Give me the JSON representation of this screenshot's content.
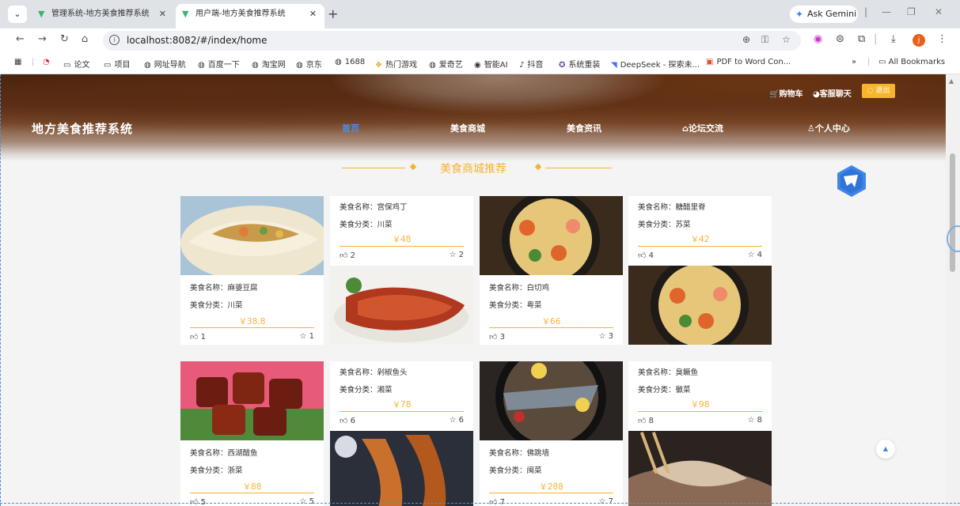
{
  "browser": {
    "tabs": [
      {
        "title": "管理系统-地方美食推荐系统",
        "close": "✕"
      },
      {
        "title": "用户端-地方美食推荐系统",
        "close": "✕"
      }
    ],
    "new_tab": "+",
    "gemini": "Ask Gemini",
    "url": "localhost:8082/#/index/home",
    "bookmarks": [
      "论文",
      "项目",
      "网址导航",
      "百度一下",
      "淘宝网",
      "京东",
      "1688",
      "热门游戏",
      "爱奇艺",
      "智能AI",
      "抖音",
      "系统重装",
      "DeepSeek - 探索未...",
      "PDF to Word Con..."
    ],
    "more": "»",
    "all_bookmarks": "All Bookmarks",
    "avatar_letter": "j",
    "accent": "#4a90e2"
  },
  "header": {
    "cart": "购物车",
    "chat": "客服聊天",
    "logout": "退出",
    "brand": "地方美食推荐系统",
    "nav": [
      {
        "label": "首页",
        "active": true
      },
      {
        "label": "美食商城",
        "active": false
      },
      {
        "label": "美食资讯",
        "active": false
      },
      {
        "label": "论坛交流",
        "active": false
      },
      {
        "label": "个人中心",
        "active": false
      }
    ]
  },
  "section": {
    "title": "美食商城推荐",
    "accent": "#f5b32f"
  },
  "labels": {
    "name": "美食名称：",
    "category": "美食分类："
  },
  "products": [
    {
      "name": "麻婆豆腐",
      "category": "川菜",
      "price": "￥38.8",
      "likes": "1",
      "favs": "1"
    },
    {
      "name": "宫保鸡丁",
      "category": "川菜",
      "price": "￥48",
      "likes": "2",
      "favs": "2"
    },
    {
      "name": "白切鸡",
      "category": "粤菜",
      "price": "￥66",
      "likes": "3",
      "favs": "3"
    },
    {
      "name": "糖醋里脊",
      "category": "苏菜",
      "price": "￥42",
      "likes": "4",
      "favs": "4"
    },
    {
      "name": "西湖醋鱼",
      "category": "浙菜",
      "price": "￥88",
      "likes": "5",
      "favs": "5"
    },
    {
      "name": "剁椒鱼头",
      "category": "湘菜",
      "price": "￥78",
      "likes": "6",
      "favs": "6"
    },
    {
      "name": "佛跳墙",
      "category": "闽菜",
      "price": "￥288",
      "likes": "7",
      "favs": "7"
    },
    {
      "name": "臭鳜鱼",
      "category": "徽菜",
      "price": "￥98",
      "likes": "8",
      "favs": "8"
    }
  ]
}
